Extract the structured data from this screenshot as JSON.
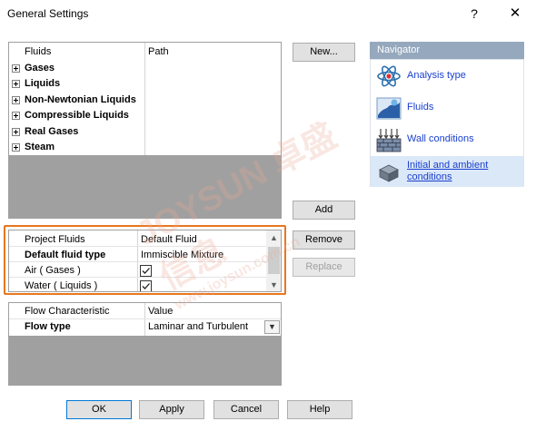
{
  "window": {
    "title": "General Settings",
    "help_glyph": "?",
    "close_glyph": "✕"
  },
  "fluids_table": {
    "headers": [
      "Fluids",
      "Path"
    ],
    "groups": [
      "Gases",
      "Liquids",
      "Non-Newtonian Liquids",
      "Compressible Liquids",
      "Real Gases",
      "Steam"
    ]
  },
  "project_fluids": {
    "headers": [
      "Project Fluids",
      "Default Fluid"
    ],
    "fluid_type_label": "Default fluid type",
    "fluid_type_value": "Immiscible Mixture",
    "items": [
      {
        "name": "Air ( Gases )",
        "checked": true
      },
      {
        "name": "Water ( Liquids )",
        "checked": true
      }
    ]
  },
  "flow_table": {
    "headers": [
      "Flow Characteristic",
      "Value"
    ],
    "flow_type_label": "Flow type",
    "flow_type_value": "Laminar and Turbulent"
  },
  "buttons": {
    "new": "New...",
    "add": "Add",
    "remove": "Remove",
    "replace": "Replace",
    "ok": "OK",
    "apply": "Apply",
    "cancel": "Cancel",
    "help": "Help"
  },
  "navigator": {
    "title": "Navigator",
    "items": [
      {
        "label": "Analysis type",
        "icon": "atom-icon",
        "selected": false
      },
      {
        "label": "Fluids",
        "icon": "fluids-icon",
        "selected": false
      },
      {
        "label": "Wall conditions",
        "icon": "wall-conditions-icon",
        "selected": false
      },
      {
        "label": "Initial and ambient conditions",
        "icon": "initial-conditions-icon",
        "selected": true
      }
    ]
  },
  "colors": {
    "highlight": "#e8771e",
    "nav_header": "#95a8bd",
    "link": "#1a3fcf"
  },
  "watermark": {
    "text": "JOYSUN 卓盛信息",
    "url": "www.joysun.com.cn"
  }
}
